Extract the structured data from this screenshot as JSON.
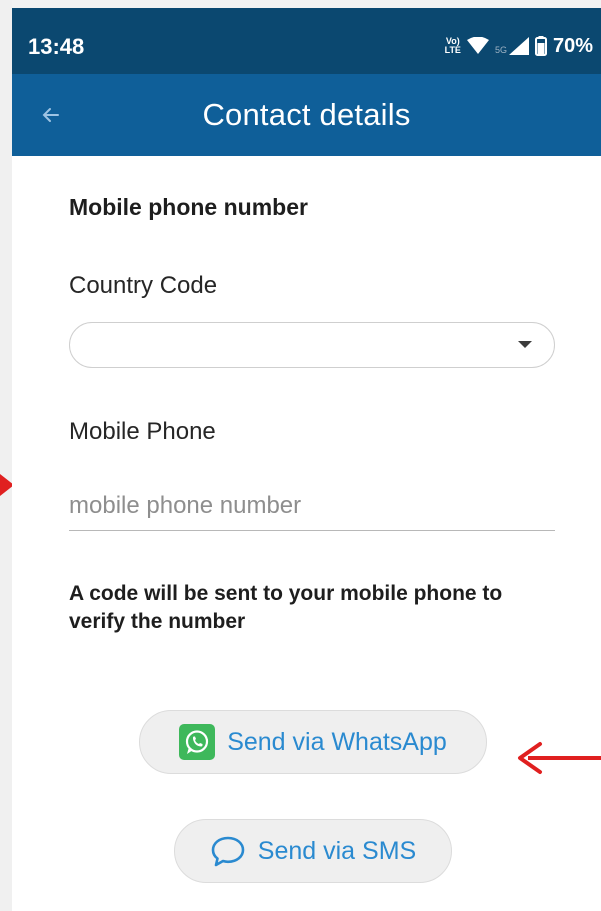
{
  "status_bar": {
    "time": "13:48",
    "volte_line1": "Vo)",
    "volte_line2": "LTE",
    "network": "5G",
    "battery": "70%"
  },
  "app_bar": {
    "title": "Contact details",
    "back_icon": "arrow-left-icon"
  },
  "form": {
    "section_title": "Mobile phone number",
    "country_code_label": "Country Code",
    "country_code_value": "",
    "mobile_phone_label": "Mobile Phone",
    "mobile_phone_placeholder": "mobile phone number",
    "mobile_phone_value": "",
    "info_text": "A code will be sent to your mobile phone to verify the number"
  },
  "actions": {
    "whatsapp_label": "Send via WhatsApp",
    "whatsapp_icon": "whatsapp-icon",
    "sms_label": "Send via SMS",
    "sms_icon": "chat-bubble-icon"
  },
  "colors": {
    "status_bar": "#0b4870",
    "app_bar": "#0f5f99",
    "accent_text": "#2a8ad0",
    "whatsapp_green": "#3eb85b",
    "annotation_arrow": "#e02020"
  }
}
